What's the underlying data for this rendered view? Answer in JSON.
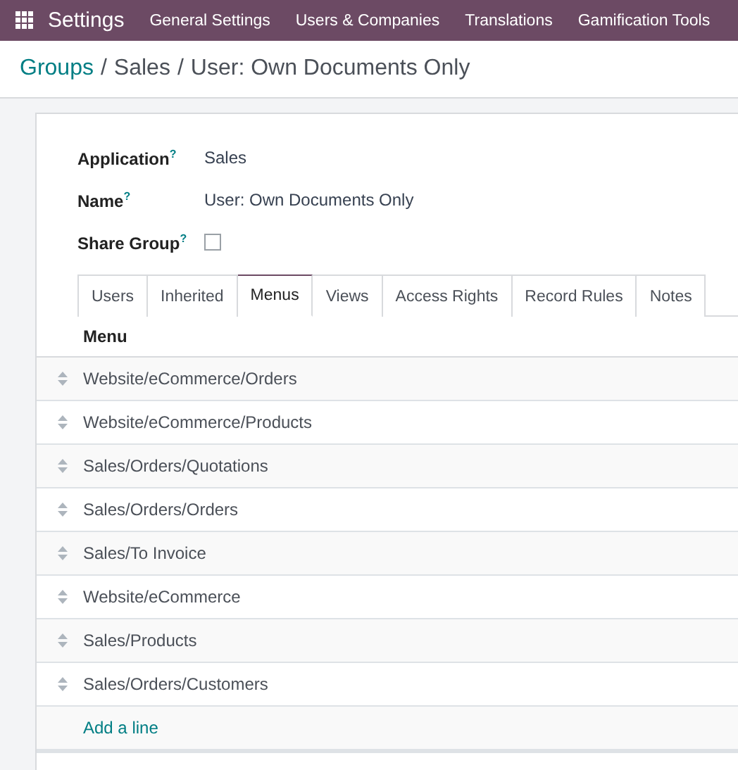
{
  "navbar": {
    "app": "Settings",
    "menu": [
      "General Settings",
      "Users & Companies",
      "Translations",
      "Gamification Tools"
    ]
  },
  "breadcrumb": [
    {
      "text": "Groups",
      "kind": "link"
    },
    {
      "text": "/",
      "kind": "sep"
    },
    {
      "text": "Sales",
      "kind": "text"
    },
    {
      "text": "/",
      "kind": "sep"
    },
    {
      "text": "User: Own Documents Only",
      "kind": "text"
    }
  ],
  "fields": [
    {
      "label": "Application$^{?}$",
      "kind": "text",
      "value": "Sales"
    },
    {
      "label": "Name$^{?}$",
      "kind": "text",
      "value": "User: Own Documents Only"
    },
    {
      "label": "Share Group$^{?}$",
      "kind": "checkbox",
      "checked": false
    }
  ],
  "tabs": [
    {
      "label": "Users",
      "selected": false
    },
    {
      "label": "Inherited",
      "selected": false
    },
    {
      "label": "Menus",
      "selected": true
    },
    {
      "label": "Views",
      "selected": false
    },
    {
      "label": "Access Rights",
      "selected": false
    },
    {
      "label": "Record Rules",
      "selected": false
    },
    {
      "label": "Notes",
      "selected": false
    }
  ],
  "table": {
    "columns": [
      "Menu"
    ],
    "rows": [
      "Website/eCommerce/Orders",
      "Website/eCommerce/Products",
      "Sales/Orders/Quotations",
      "Sales/Orders/Orders",
      "Sales/To Invoice",
      "Website/eCommerce",
      "Sales/Products",
      "Sales/Orders/Customers"
    ],
    "add_line": "Add a line"
  }
}
